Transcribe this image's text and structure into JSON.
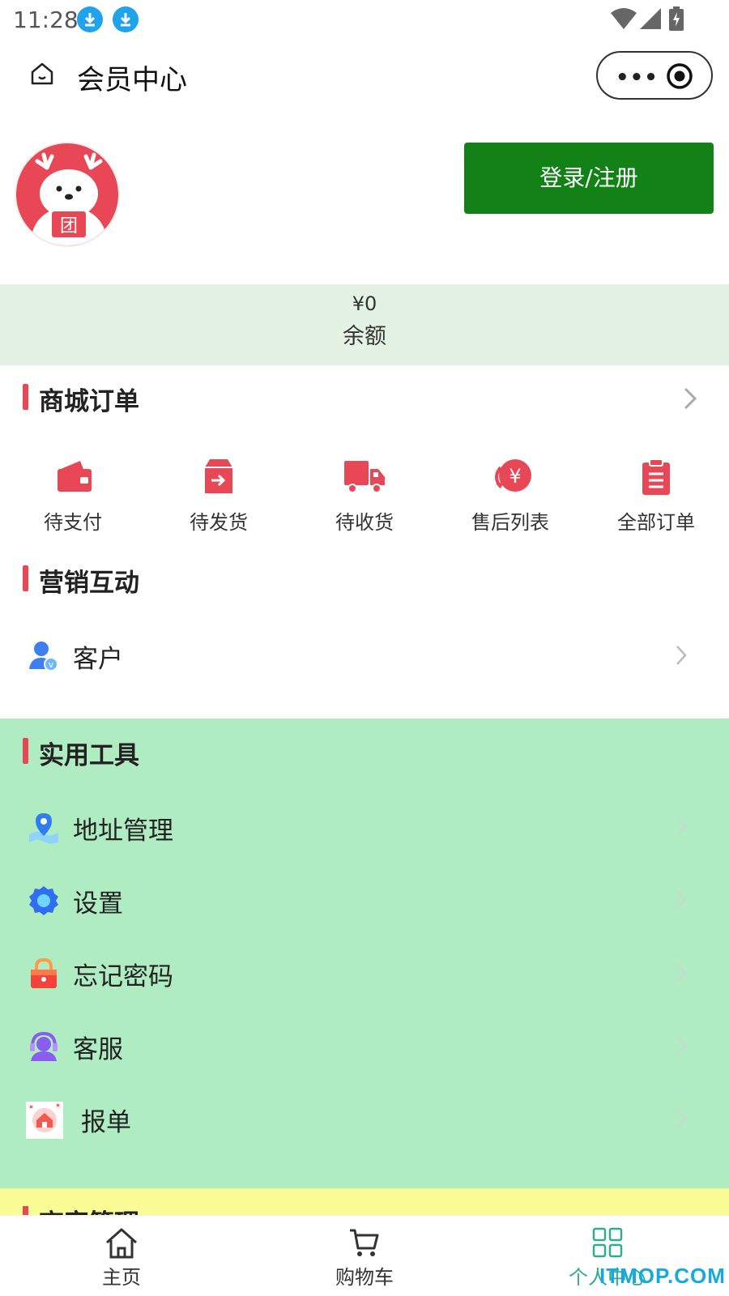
{
  "status_bar": {
    "time": "11:28"
  },
  "nav": {
    "title": "会员中心",
    "more": "•••"
  },
  "profile": {
    "login_label": "登录/注册",
    "avatar_badge": "团"
  },
  "balance": {
    "value": "¥0",
    "label": "余额"
  },
  "orders": {
    "title": "商城订单",
    "items": [
      {
        "label": "待支付",
        "icon": "wallet-icon"
      },
      {
        "label": "待发货",
        "icon": "box-icon"
      },
      {
        "label": "待收货",
        "icon": "truck-icon"
      },
      {
        "label": "售后列表",
        "icon": "refund-icon"
      },
      {
        "label": "全部订单",
        "icon": "clipboard-icon"
      }
    ]
  },
  "marketing": {
    "title": "营销互动",
    "items": [
      {
        "label": "客户",
        "icon": "customer-icon"
      }
    ]
  },
  "tools": {
    "title": "实用工具",
    "items": [
      {
        "label": "地址管理",
        "icon": "map-pin-icon"
      },
      {
        "label": "设置",
        "icon": "gear-icon"
      },
      {
        "label": "忘记密码",
        "icon": "lock-icon"
      },
      {
        "label": "客服",
        "icon": "headset-icon"
      },
      {
        "label": "报单",
        "icon": "house-icon"
      }
    ]
  },
  "merchant": {
    "title": "商家管理"
  },
  "tab_bar": {
    "items": [
      {
        "label": "主页",
        "icon": "home-icon"
      },
      {
        "label": "购物车",
        "icon": "cart-icon"
      },
      {
        "label": "个人中心",
        "icon": "grid-icon"
      }
    ],
    "active_index": 2
  },
  "watermark": "ITMOP.COM",
  "colors": {
    "accent_red": "#e84855",
    "login_green": "#128217",
    "tools_bg": "#afecc1",
    "balance_bg": "#e4f2e4",
    "active_tab": "#2fae8a"
  }
}
